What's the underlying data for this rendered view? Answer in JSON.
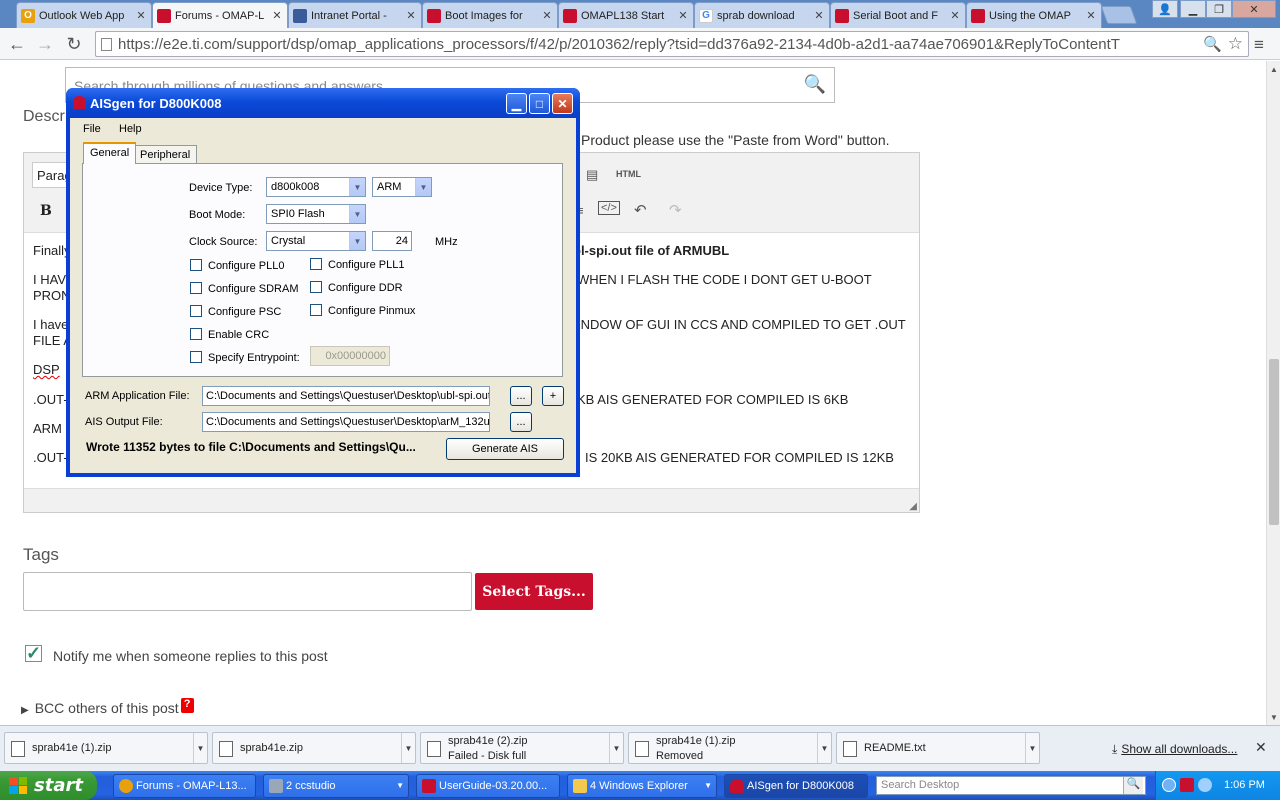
{
  "browser": {
    "tabs": [
      {
        "title": "Outlook Web App",
        "icon": "outlook-icon"
      },
      {
        "title": "Forums - OMAP-L",
        "icon": "ti-icon"
      },
      {
        "title": "Intranet Portal -",
        "icon": "intranet-icon"
      },
      {
        "title": "Boot Images for",
        "icon": "ti-icon"
      },
      {
        "title": "OMAPL138 Start",
        "icon": "ti-icon"
      },
      {
        "title": "sprab download",
        "icon": "google-icon"
      },
      {
        "title": "Serial Boot and F",
        "icon": "ti-icon"
      },
      {
        "title": "Using the OMAP",
        "icon": "ti-icon"
      }
    ],
    "url": "https://e2e.ti.com/support/dsp/omap_applications_processors/f/42/p/2010362/reply?tsid=dd376a92-2134-4d0b-a2d1-aa74ae706901&ReplyToContentT"
  },
  "page": {
    "search_placeholder": "Search through millions of questions and answers",
    "description_label": "Descr",
    "paste_note": "Product please use the \"Paste from Word\" button.",
    "editor": {
      "paragraph": "Parag",
      "bold": "B",
      "html_label": "HTML",
      "lines": [
        {
          "pre": "Finally",
          "rest": "bl-spi.out file of ARMUBL"
        },
        {
          "pre": "I HAV",
          "rest": "WHEN I FLASH THE CODE I DONT GET U-BOOT"
        },
        {
          "pre": "PRON",
          "rest": ""
        },
        {
          "pre": "I have",
          "rest": "INDOW OF GUI IN CCS AND COMPILED TO GET .OUT"
        },
        {
          "pre": "FILE A",
          "rest": ""
        },
        {
          "pre": "DSP",
          "rest": ""
        },
        {
          "pre": ".OUT-",
          "rest": "KB AIS GENERATED FOR COMPILED IS 6KB"
        },
        {
          "pre": "ARM",
          "rest": ""
        },
        {
          "pre": ".OUT-",
          "rest": "IS 20KB AIS GENERATED FOR COMPILED IS 12KB"
        }
      ]
    },
    "tags_label": "Tags",
    "select_tags": "Select Tags...",
    "notify_label": "Notify me when someone replies to this post",
    "bcc_label": "BCC others of this post",
    "help_mark": "?"
  },
  "dialog": {
    "title": "AISgen for D800K008",
    "menu": [
      "File",
      "Help"
    ],
    "tabs": [
      "General",
      "Peripheral"
    ],
    "device_type_label": "Device Type:",
    "device_type": "d800k008",
    "cpu": "ARM",
    "boot_mode_label": "Boot Mode:",
    "boot_mode": "SPI0 Flash",
    "clock_source_label": "Clock Source:",
    "clock_source": "Crystal",
    "clock_freq": "24",
    "clock_unit": "MHz",
    "checkboxes": [
      {
        "label": "Configure PLL0",
        "checked": false
      },
      {
        "label": "Configure PLL1",
        "checked": false
      },
      {
        "label": "Configure SDRAM",
        "checked": false
      },
      {
        "label": "Configure DDR",
        "checked": false
      },
      {
        "label": "Configure PSC",
        "checked": false
      },
      {
        "label": "Configure Pinmux",
        "checked": false
      },
      {
        "label": "Enable CRC",
        "checked": false
      },
      {
        "label": "Specify Entrypoint:",
        "checked": false
      }
    ],
    "entrypoint": "0x00000000",
    "arm_app_label": "ARM Application File:",
    "arm_app_value": "C:\\Documents and Settings\\Questuser\\Desktop\\ubl-spi.out",
    "ais_out_label": "AIS Output File:",
    "ais_out_value": "C:\\Documents and Settings\\Questuser\\Desktop\\arM_132u",
    "browse_label": "...",
    "add_label": "+",
    "status": "Wrote 11352 bytes to file C:\\Documents and Settings\\Qu...",
    "generate_label": "Generate AIS"
  },
  "downloads": {
    "items": [
      {
        "name": "sprab41e (1).zip",
        "status": ""
      },
      {
        "name": "sprab41e.zip",
        "status": ""
      },
      {
        "name": "sprab41e (2).zip",
        "status": "Failed - Disk full"
      },
      {
        "name": "sprab41e (1).zip",
        "status": "Removed"
      },
      {
        "name": "README.txt",
        "status": ""
      }
    ],
    "show_all": "Show all downloads..."
  },
  "taskbar": {
    "start": "start",
    "buttons": [
      {
        "label": "Forums - OMAP-L13...",
        "icon_color": "#e8a10c"
      },
      {
        "label": "2 ccstudio",
        "icon_color": "#9aa7b8"
      },
      {
        "label": "UserGuide-03.20.00...",
        "icon_color": "#c8102e"
      },
      {
        "label": "4 Windows Explorer",
        "icon_color": "#f2c94c"
      },
      {
        "label": "AISgen for D800K008",
        "icon_color": "#c8102e"
      }
    ],
    "search_placeholder": "Search Desktop",
    "time": "1:06 PM"
  }
}
